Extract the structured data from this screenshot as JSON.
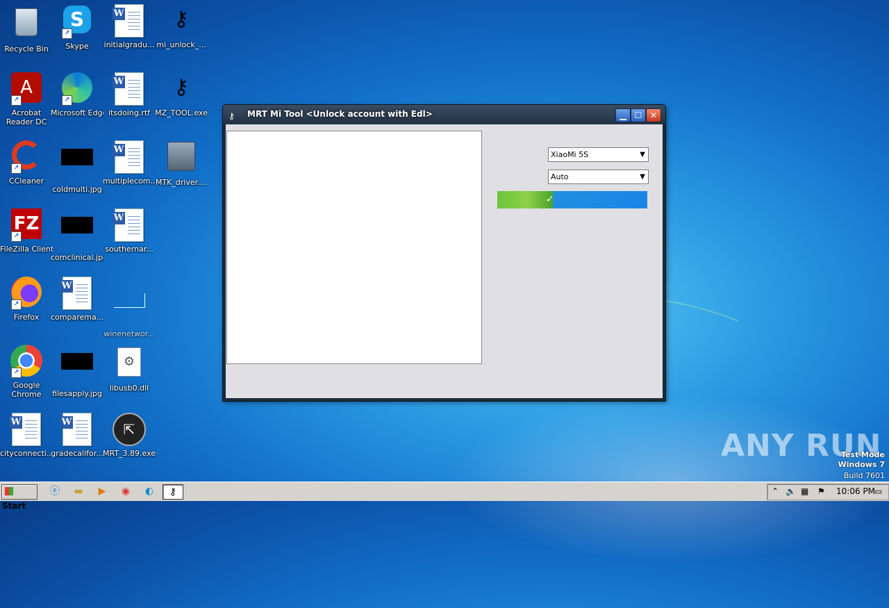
{
  "desktop": {
    "icons": [
      {
        "label": "Recycle Bin",
        "icon": "recycle-bin-icon"
      },
      {
        "label": "Skype",
        "icon": "skype-icon"
      },
      {
        "label": "initialgradu...",
        "icon": "word-doc-icon"
      },
      {
        "label": "mi_unlock_...",
        "icon": "key-icon"
      },
      {
        "label": "Acrobat Reader DC",
        "icon": "acrobat-icon"
      },
      {
        "label": "Microsoft Edge",
        "icon": "edge-icon"
      },
      {
        "label": "itsdoing.rtf",
        "icon": "word-doc-icon"
      },
      {
        "label": "MZ_TOOL.exe",
        "icon": "key-icon"
      },
      {
        "label": "CCleaner",
        "icon": "ccleaner-icon"
      },
      {
        "label": "coldmulti.jpg",
        "icon": "image-thumb-icon"
      },
      {
        "label": "multiplecom...",
        "icon": "word-doc-icon"
      },
      {
        "label": "MTK_driver....",
        "icon": "installer-icon"
      },
      {
        "label": "FileZilla Client",
        "icon": "filezilla-icon"
      },
      {
        "label": "comclinical.jpg",
        "icon": "image-thumb-icon"
      },
      {
        "label": "southernar...",
        "icon": "word-doc-icon"
      },
      {
        "label": "Firefox",
        "icon": "firefox-icon"
      },
      {
        "label": "comparema...",
        "icon": "word-doc-icon"
      },
      {
        "label": "winenetwor...",
        "icon": "blank-file-icon"
      },
      {
        "label": "Google Chrome",
        "icon": "chrome-icon"
      },
      {
        "label": "filesapply.jpg",
        "icon": "image-thumb-icon"
      },
      {
        "label": "libusb0.dll",
        "icon": "dll-icon"
      },
      {
        "label": "cityconnecti...",
        "icon": "word-doc-icon"
      },
      {
        "label": "gradecalifor...",
        "icon": "word-doc-icon"
      },
      {
        "label": "MRT_3.89.exe",
        "icon": "mrt-exe-icon"
      }
    ]
  },
  "window": {
    "title": "MRT Mi Tool <Unlock account with Edl>",
    "model_select": {
      "value": "XiaoMi 5S"
    },
    "mode_select": {
      "value": "Auto"
    }
  },
  "taskbar": {
    "start_label": "Start",
    "clock": "10:06 PM"
  },
  "watermark": {
    "line1": "Test Mode",
    "line2": "Windows 7",
    "line3": "Build 7601",
    "brand": "ANY RUN"
  },
  "colors": {
    "accent": "#1a86e6",
    "taskbar": "#d6d3ce"
  }
}
